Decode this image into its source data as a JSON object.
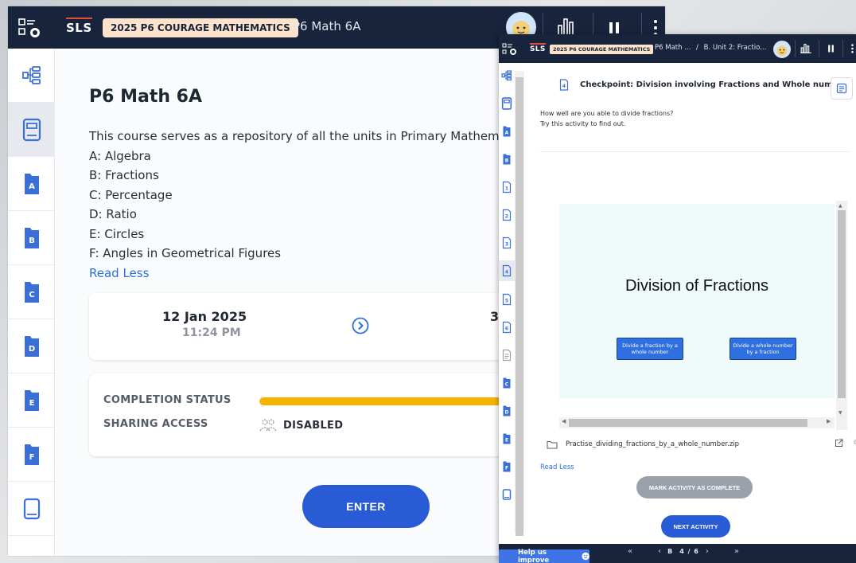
{
  "colors": {
    "topbar": "#17243b",
    "pill_bg": "#fde2cc",
    "accent_blue": "#2a5bd7",
    "link_blue": "#2c6fdc",
    "progress_yellow": "#f6b400",
    "disabled_gray": "#9aa1ab"
  },
  "back_window": {
    "header": {
      "logo": "SLS",
      "course_pill": "2025 P6 COURAGE MATHEMATICS",
      "breadcrumb": "P6 Math 6A",
      "icons": [
        "menu-grid-icon",
        "avatar",
        "stats-chart-icon",
        "pause-icon",
        "more-vertical-icon"
      ]
    },
    "sidenav": {
      "items": [
        {
          "icon": "tree-structure-icon"
        },
        {
          "icon": "notebook-icon",
          "active": true
        },
        {
          "icon": "folder-icon",
          "label": "A"
        },
        {
          "icon": "folder-icon",
          "label": "B"
        },
        {
          "icon": "folder-icon",
          "label": "C"
        },
        {
          "icon": "folder-icon",
          "label": "D"
        },
        {
          "icon": "folder-icon",
          "label": "E"
        },
        {
          "icon": "folder-icon",
          "label": "F"
        },
        {
          "icon": "book-icon"
        }
      ]
    },
    "course": {
      "title": "P6 Math 6A",
      "description_lines": [
        "This course serves as a repository of all the units in Primary Mathema",
        "A: Algebra",
        "B: Fractions",
        "C: Percentage",
        "D: Ratio",
        "E: Circles",
        "F: Angles in Geometrical Figures"
      ],
      "read_less": "Read Less"
    },
    "dates": {
      "start_date": "12 Jan 2025",
      "start_time": "11:24 PM",
      "end_partial": "3"
    },
    "status": {
      "completion_label": "COMPLETION STATUS",
      "completion_percent": 100,
      "sharing_label": "SHARING ACCESS",
      "sharing_value": "DISABLED"
    },
    "enter_label": "ENTER"
  },
  "front_window": {
    "header": {
      "logo": "SLS",
      "course_pill": "2025 P6 COURAGE MATHEMATICS",
      "breadcrumb_1": "P6 Math ...",
      "breadcrumb_sep": "/",
      "breadcrumb_2": "B. Unit 2: Fractio..."
    },
    "sidenav": {
      "items": [
        {
          "icon": "tree-structure-icon"
        },
        {
          "icon": "notebook-icon"
        },
        {
          "icon": "folder-icon",
          "label": "A"
        },
        {
          "icon": "folder-icon",
          "label": "B"
        },
        {
          "icon": "page-icon",
          "label": "1"
        },
        {
          "icon": "page-icon",
          "label": "2"
        },
        {
          "icon": "page-icon",
          "label": "3"
        },
        {
          "icon": "page-icon",
          "label": "4",
          "active": true
        },
        {
          "icon": "page-icon",
          "label": "5"
        },
        {
          "icon": "page-icon",
          "label": "6"
        },
        {
          "icon": "document-icon"
        },
        {
          "icon": "folder-icon",
          "label": "C"
        },
        {
          "icon": "folder-icon",
          "label": "D"
        },
        {
          "icon": "folder-icon",
          "label": "E"
        },
        {
          "icon": "folder-icon",
          "label": "F"
        },
        {
          "icon": "book-icon"
        }
      ]
    },
    "checkpoint": {
      "page_number": "4",
      "title": "Checkpoint: Division involving Fractions and Whole number",
      "desc_line1": "How well are you able to divide fractions?",
      "desc_line2": "Try this activity to find out."
    },
    "activity": {
      "title": "Division of Fractions",
      "option_1": "Divide a fraction by a whole number",
      "option_2": "Divide a whole number by a fraction"
    },
    "file": {
      "name": "Practise_dividing_fractions_by_a_whole_number.zip",
      "extra": "©"
    },
    "read_less": "Read Less",
    "mark_complete": "MARK ACTIVITY AS COMPLETE",
    "next_activity": "NEXT ACTIVITY",
    "help": "Help us improve",
    "pager": {
      "first": "«",
      "prev": "‹",
      "section": "B",
      "page": "4 / 6",
      "next": "›",
      "last": "»"
    }
  }
}
